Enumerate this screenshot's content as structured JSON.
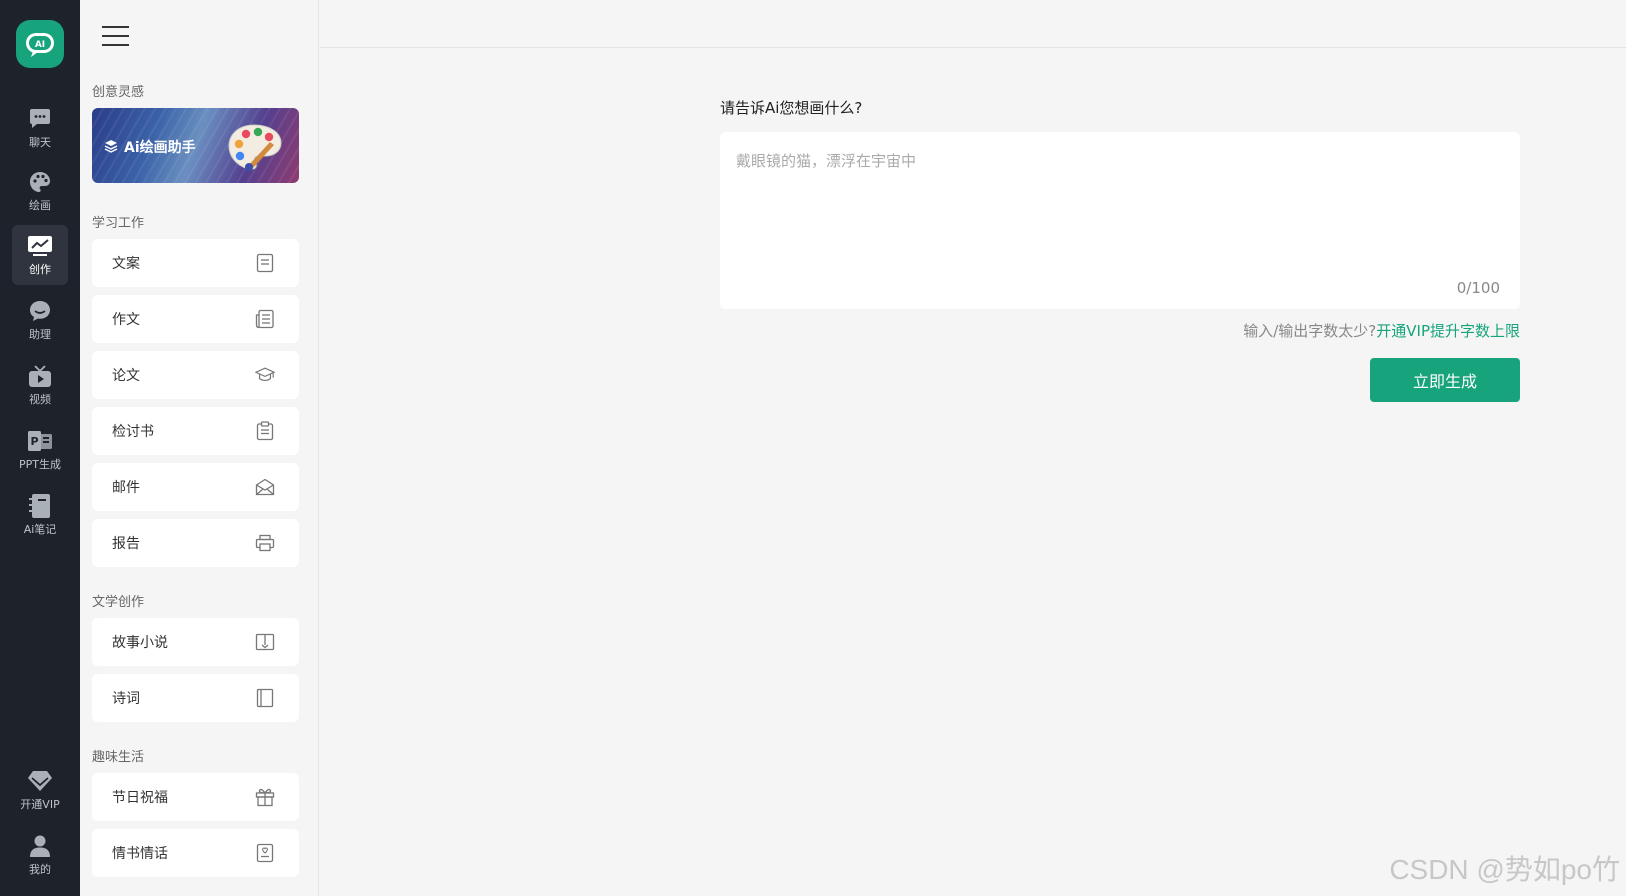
{
  "rail": {
    "logo_text": "AI",
    "items": [
      {
        "label": "聊天",
        "icon": "chat-bubble-icon"
      },
      {
        "label": "绘画",
        "icon": "palette-icon"
      },
      {
        "label": "创作",
        "icon": "trend-chart-icon",
        "active": true
      },
      {
        "label": "助理",
        "icon": "assistant-bubble-icon"
      },
      {
        "label": "视频",
        "icon": "tv-icon"
      },
      {
        "label": "PPT生成",
        "icon": "ppt-icon"
      },
      {
        "label": "Ai笔记",
        "icon": "notebook-icon"
      }
    ],
    "bottom": [
      {
        "label": "开通VIP",
        "icon": "diamond-icon"
      },
      {
        "label": "我的",
        "icon": "user-icon"
      }
    ]
  },
  "sidebar": {
    "group1": {
      "title": "创意灵感",
      "banner_label": "Ai绘画助手"
    },
    "group2": {
      "title": "学习工作",
      "items": [
        {
          "label": "文案",
          "icon": "document-icon"
        },
        {
          "label": "作文",
          "icon": "newspaper-icon"
        },
        {
          "label": "论文",
          "icon": "graduation-cap-icon"
        },
        {
          "label": "检讨书",
          "icon": "clipboard-icon"
        },
        {
          "label": "邮件",
          "icon": "envelope-icon"
        },
        {
          "label": "报告",
          "icon": "printer-icon"
        }
      ]
    },
    "group3": {
      "title": "文学创作",
      "items": [
        {
          "label": "故事小说",
          "icon": "open-book-icon"
        },
        {
          "label": "诗词",
          "icon": "book-icon"
        }
      ]
    },
    "group4": {
      "title": "趣味生活",
      "items": [
        {
          "label": "节日祝福",
          "icon": "gift-icon"
        },
        {
          "label": "情书情话",
          "icon": "love-letter-icon"
        }
      ]
    }
  },
  "main": {
    "question": "请告诉Ai您想画什么?",
    "placeholder": "戴眼镜的猫，漂浮在宇宙中",
    "counter": "0/100",
    "vip_hint": "输入/输出字数太少?",
    "vip_link": "开通VIP提升字数上限",
    "generate_label": "立即生成"
  },
  "watermark": "CSDN @势如po竹",
  "colors": {
    "brand": "#17a37c",
    "rail_bg": "#1e222b",
    "page_bg": "#f5f5f5"
  }
}
